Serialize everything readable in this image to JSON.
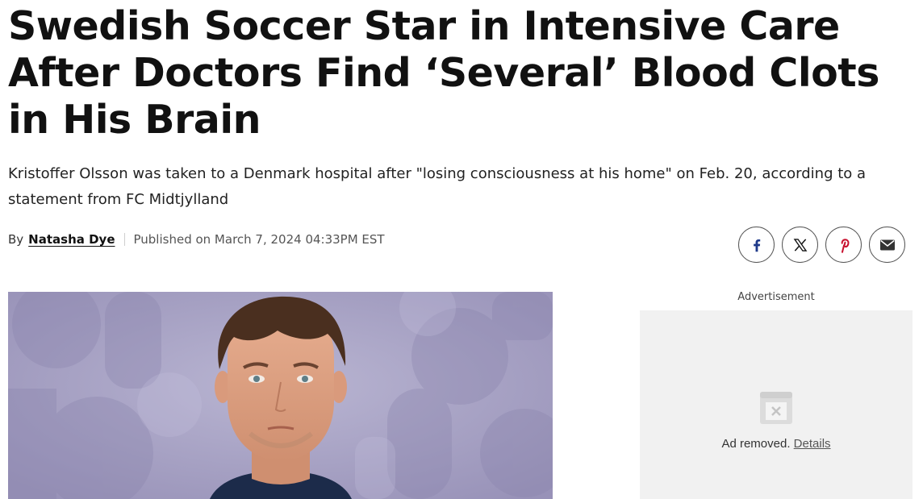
{
  "article": {
    "headline": "Swedish Soccer Star in Intensive Care After Doctors Find ‘Several’ Blood Clots in His Brain",
    "dek": "Kristoffer Olsson was taken to a Denmark hospital after \"losing consciousness at his home\" on Feb. 20, according to a statement from FC Midtjylland",
    "byline": {
      "prefix": "By",
      "author": "Natasha Dye",
      "published": "Published on March 7, 2024 04:33PM EST"
    }
  },
  "share": [
    {
      "name": "facebook",
      "icon": "facebook-icon",
      "color": "#1f3a8a"
    },
    {
      "name": "x",
      "icon": "x-icon",
      "color": "#111111"
    },
    {
      "name": "pinterest",
      "icon": "pinterest-icon",
      "color": "#c8102e"
    },
    {
      "name": "email",
      "icon": "envelope-icon",
      "color": "#333333"
    }
  ],
  "advertisement": {
    "label": "Advertisement",
    "removed_text": "Ad removed.",
    "details_link": "Details"
  },
  "colors": {
    "hero_background": "#a5a0c2",
    "ad_background": "#f1f1f1"
  }
}
